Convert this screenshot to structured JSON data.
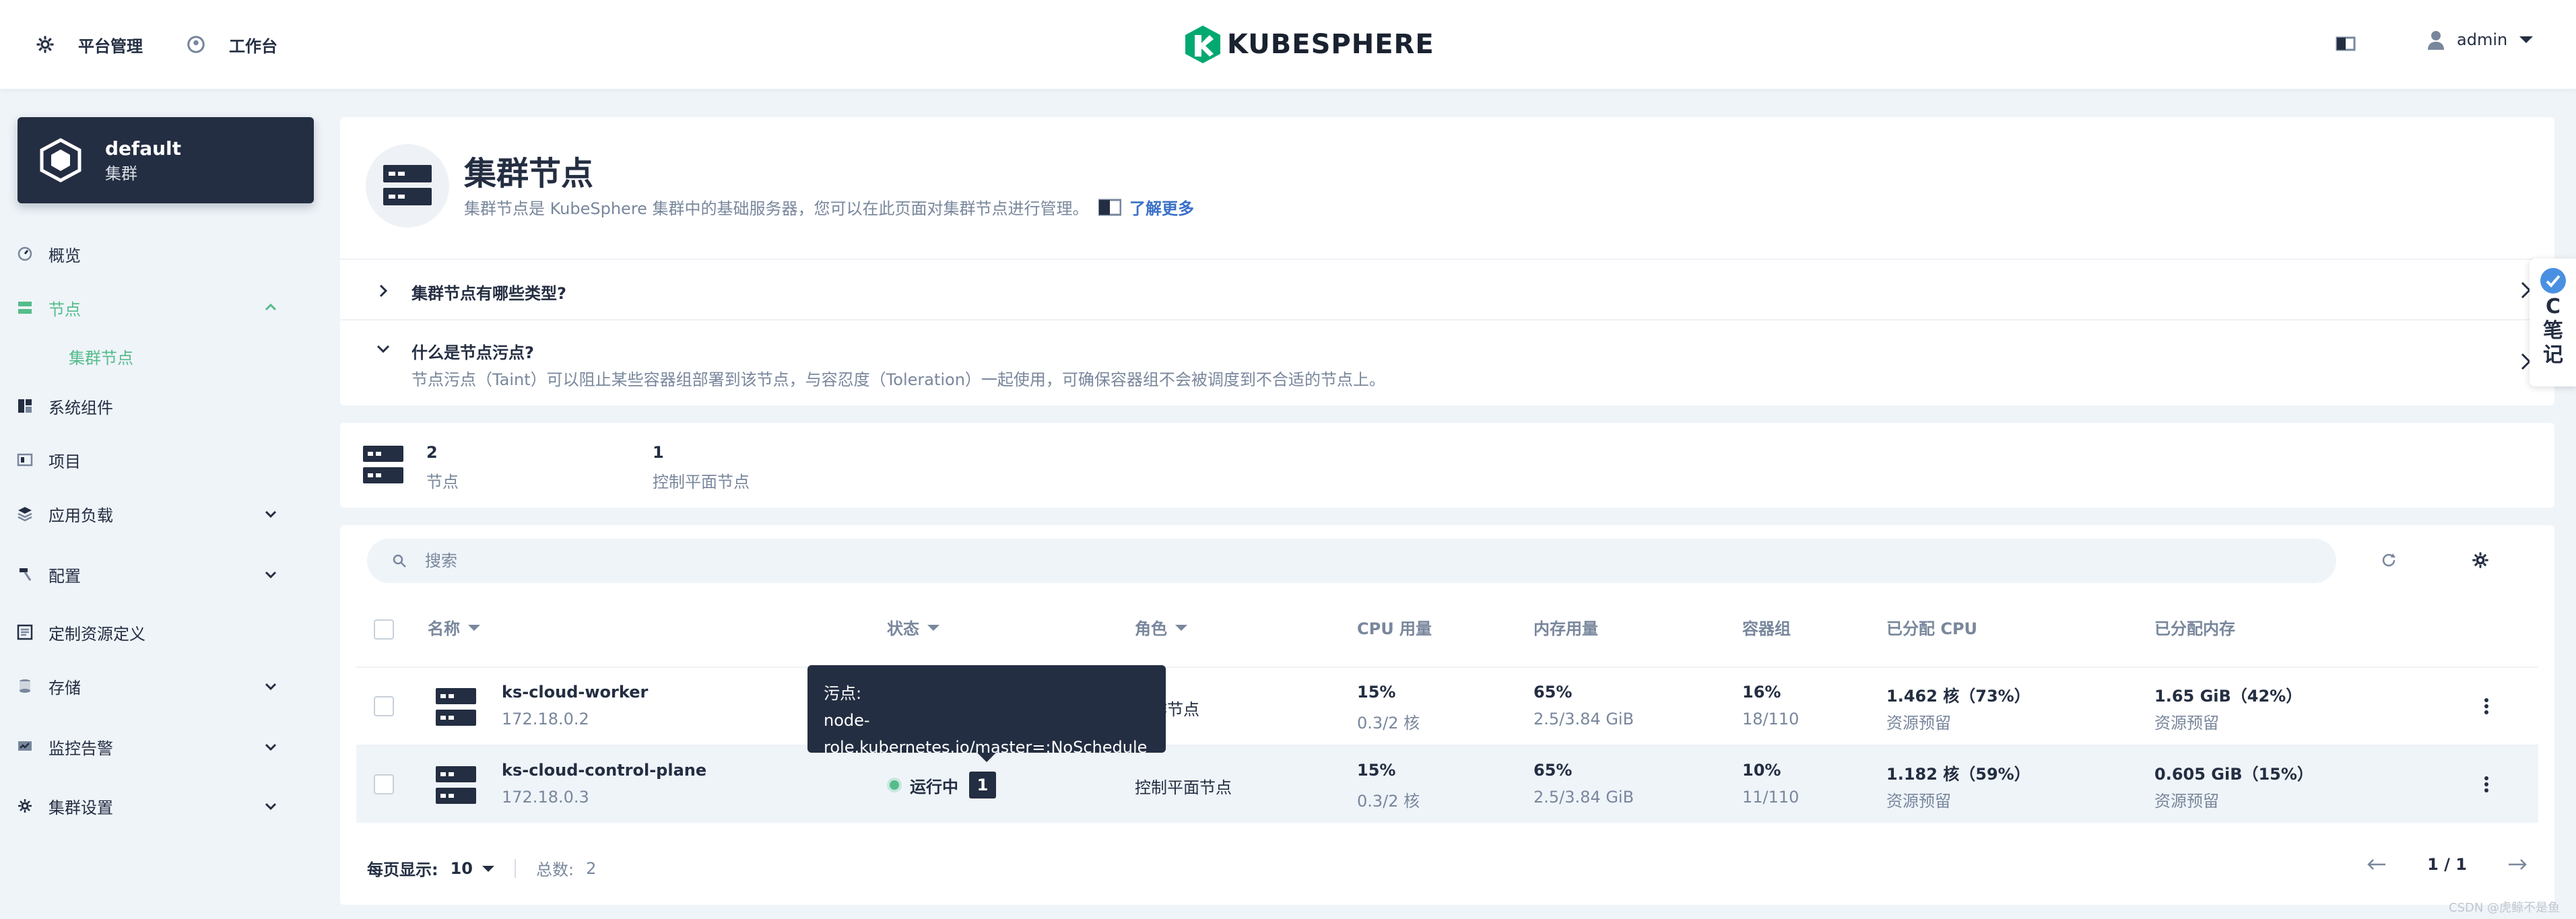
{
  "topbar": {
    "platform_label": "平台管理",
    "workbench_label": "工作台",
    "logo_text": "KUBESPHERE",
    "user_name": "admin"
  },
  "sidebar": {
    "cluster_name": "default",
    "cluster_type": "集群",
    "items": [
      {
        "label": "概览",
        "icon": "dashboard-icon"
      },
      {
        "label": "节点",
        "icon": "nodes-icon",
        "expanded": true
      },
      {
        "label": "系统组件",
        "icon": "components-icon"
      },
      {
        "label": "项目",
        "icon": "project-icon"
      },
      {
        "label": "应用负载",
        "icon": "workload-icon"
      },
      {
        "label": "配置",
        "icon": "hammer-icon"
      },
      {
        "label": "定制资源定义",
        "icon": "crd-icon"
      },
      {
        "label": "存储",
        "icon": "storage-icon"
      },
      {
        "label": "监控告警",
        "icon": "monitor-icon"
      },
      {
        "label": "集群设置",
        "icon": "gear-icon"
      }
    ],
    "sub_item": "集群节点"
  },
  "header": {
    "title": "集群节点",
    "description": "集群节点是 KubeSphere 集群中的基础服务器，您可以在此页面对集群节点进行管理。",
    "learn_more": "了解更多",
    "faq": [
      {
        "question": "集群节点有哪些类型?",
        "answer": ""
      },
      {
        "question": "什么是节点污点?",
        "answer": "节点污点（Taint）可以阻止某些容器组部署到该节点，与容忍度（Toleration）一起使用，可确保容器组不会被调度到不合适的节点上。"
      }
    ]
  },
  "stats": [
    {
      "value": "2",
      "label": "节点"
    },
    {
      "value": "1",
      "label": "控制平面节点"
    }
  ],
  "table": {
    "search_placeholder": "搜索",
    "columns": [
      "名称",
      "状态",
      "角色",
      "CPU 用量",
      "内存用量",
      "容器组",
      "已分配 CPU",
      "已分配内存"
    ],
    "rows": [
      {
        "name": "ks-cloud-worker",
        "ip": "172.18.0.2",
        "status": "",
        "role": "工作节点",
        "cpu": "15%",
        "cpu_sub": "0.3/2 核",
        "mem": "65%",
        "mem_sub": "2.5/3.84 GiB",
        "pods": "16%",
        "pods_sub": "18/110",
        "alloc_cpu": "1.462 核（73%）",
        "alloc_cpu_sub": "资源预留",
        "alloc_mem": "1.65 GiB（42%）",
        "alloc_mem_sub": "资源预留"
      },
      {
        "name": "ks-cloud-control-plane",
        "ip": "172.18.0.3",
        "status": "运行中",
        "taint_count": "1",
        "role": "控制平面节点",
        "cpu": "15%",
        "cpu_sub": "0.3/2 核",
        "mem": "65%",
        "mem_sub": "2.5/3.84 GiB",
        "pods": "10%",
        "pods_sub": "11/110",
        "alloc_cpu": "1.182 核（59%）",
        "alloc_cpu_sub": "资源预留",
        "alloc_mem": "0.605 GiB（15%）",
        "alloc_mem_sub": "资源预留"
      }
    ],
    "tooltip_title": "污点:",
    "tooltip_body": "node-role.kubernetes.io/master=:NoSchedule",
    "page_size_label": "每页显示:",
    "page_size": "10",
    "total_label": "总数:",
    "total": "2",
    "page": "1 / 1"
  },
  "float_note": {
    "line1": "C",
    "line2": "笔",
    "line3": "记"
  },
  "watermark": "CSDN @虎鲸不是鱼",
  "colors": {
    "accent": "#55bc8a",
    "dark": "#242e42",
    "muted": "#79879c",
    "link": "#3385ff"
  }
}
